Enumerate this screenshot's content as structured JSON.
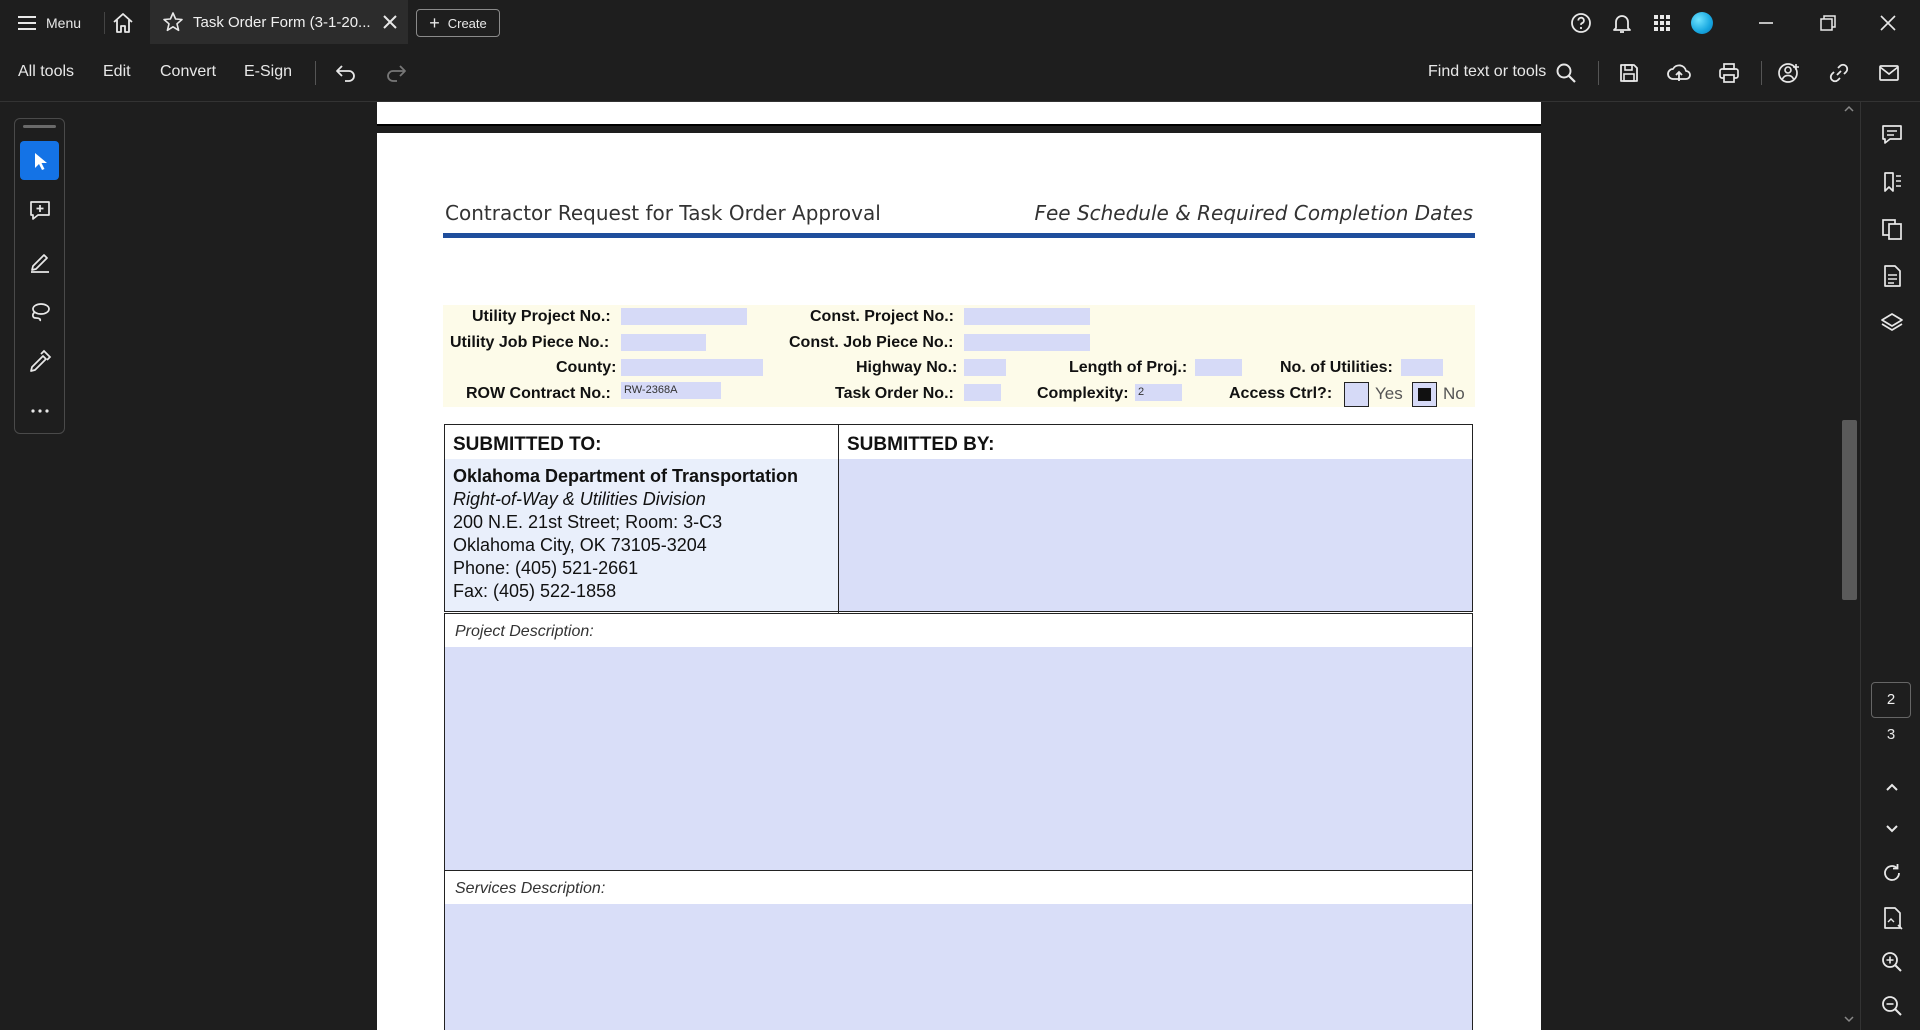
{
  "titlebar": {
    "menu_label": "Menu",
    "tab_title": "Task Order Form (3-1-20...",
    "create_label": "Create"
  },
  "toolbar": {
    "all_tools": "All tools",
    "edit": "Edit",
    "convert": "Convert",
    "esign": "E-Sign",
    "find_label": "Find text or tools"
  },
  "navigation": {
    "current_page": "2",
    "next_page": "3"
  },
  "document": {
    "title_left": "Contractor Request for Task Order Approval",
    "title_right": "Fee Schedule & Required Completion Dates",
    "fields": {
      "utility_project_no": {
        "label": "Utility Project No.:",
        "value": ""
      },
      "const_project_no": {
        "label": "Const. Project No.:",
        "value": ""
      },
      "utility_job_piece_no": {
        "label": "Utility Job Piece No.:",
        "value": ""
      },
      "const_job_piece_no": {
        "label": "Const. Job Piece No.:",
        "value": ""
      },
      "county": {
        "label": "County:",
        "value": ""
      },
      "highway_no": {
        "label": "Highway No.:",
        "value": ""
      },
      "length_of_proj": {
        "label": "Length of Proj.:",
        "value": ""
      },
      "no_of_utilities": {
        "label": "No. of Utilities:",
        "value": ""
      },
      "row_contract_no": {
        "label": "ROW Contract No.:",
        "value": "RW-2368A"
      },
      "task_order_no": {
        "label": "Task Order No.:",
        "value": ""
      },
      "complexity": {
        "label": "Complexity:",
        "value": "2"
      },
      "access_ctrl": {
        "label": "Access Ctrl?:",
        "yes_label": "Yes",
        "no_label": "No",
        "selected": "No"
      }
    },
    "submitted_to": {
      "header": "SUBMITTED TO:",
      "org": "Oklahoma Department of Transportation",
      "division": "Right-of-Way & Utilities Division",
      "address1": "200 N.E. 21st Street; Room: 3-C3",
      "address2": "Oklahoma City, OK  73105-3204",
      "phone": "Phone: (405) 521-2661",
      "fax": "Fax: (405) 522-1858"
    },
    "submitted_by": {
      "header": "SUBMITTED BY:",
      "value": ""
    },
    "project_description": {
      "label": "Project Description:",
      "value": ""
    },
    "services_description": {
      "label": "Services Description:",
      "value": ""
    }
  },
  "icons": {
    "titlebar": [
      "menu-icon",
      "home-icon",
      "star-icon",
      "close-icon",
      "plus-icon",
      "help-icon",
      "bell-icon",
      "apps-grid-icon",
      "avatar",
      "minimize-icon",
      "restore-icon",
      "window-close-icon"
    ],
    "toolbar": [
      "undo-icon",
      "redo-icon",
      "search-icon",
      "save-icon",
      "upload-cloud-icon",
      "print-icon",
      "share-user-icon",
      "link-icon",
      "mail-icon"
    ],
    "left_rail": [
      "select-arrow-icon",
      "add-comment-icon",
      "highlight-pen-icon",
      "lasso-icon",
      "sign-pen-icon",
      "more-icon"
    ],
    "right_rail": [
      "comments-icon",
      "bookmarks-icon",
      "pages-icon",
      "document-icon",
      "layers-icon",
      "chevron-up-icon",
      "chevron-down-icon",
      "refresh-icon",
      "page-fit-icon",
      "zoom-in-icon",
      "zoom-out-icon"
    ]
  },
  "colors": {
    "accent": "#1473e6",
    "doc_rule": "#1f4e9c",
    "field_fill": "#d6daf7",
    "info_bg": "#fdfbe9"
  }
}
